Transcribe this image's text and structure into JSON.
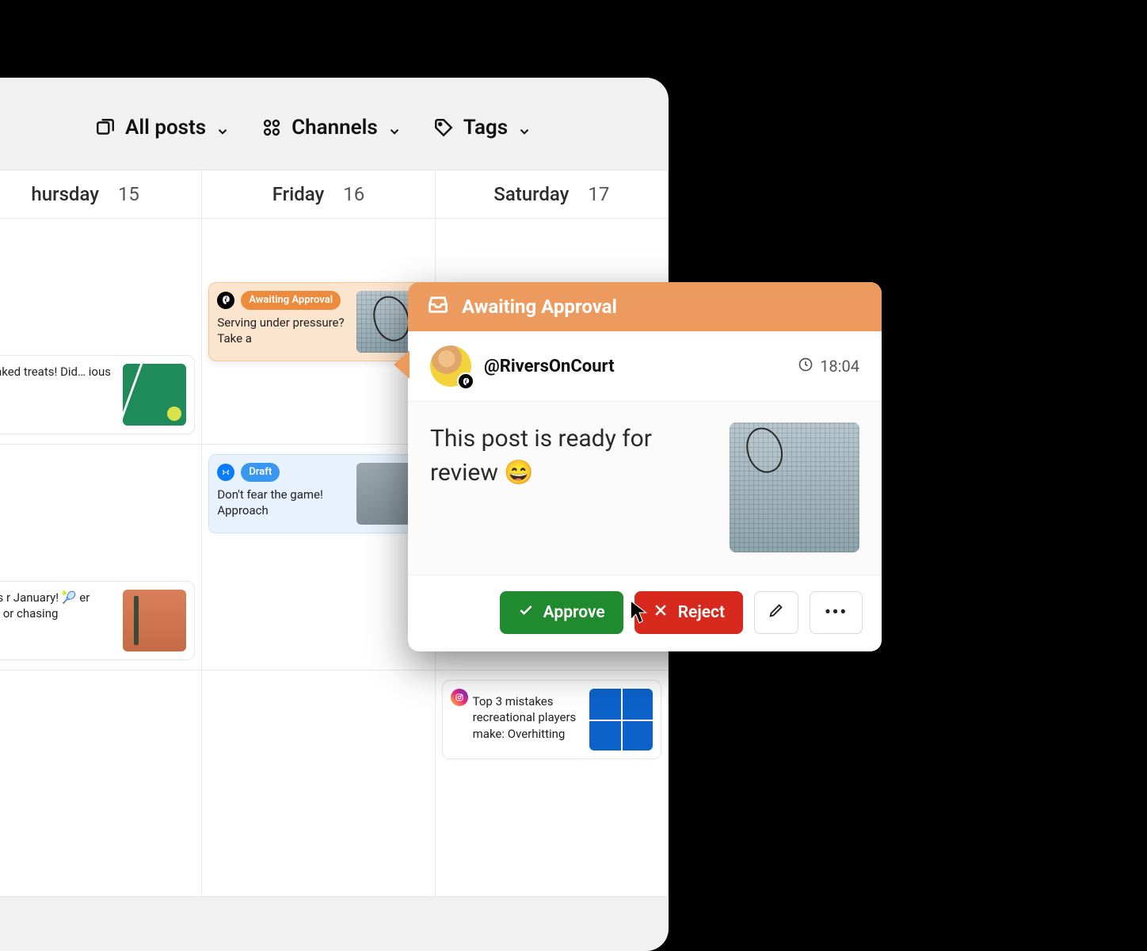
{
  "filters": {
    "all_posts": "All posts",
    "channels": "Channels",
    "tags": "Tags"
  },
  "calendar": {
    "columns": [
      {
        "day": "hursday",
        "date": "15"
      },
      {
        "day": "Friday",
        "date": "16"
      },
      {
        "day": "Saturday",
        "date": "17"
      }
    ]
  },
  "cards": {
    "approval": {
      "badge": "Awaiting Approval",
      "text": "Serving under pressure? Take a"
    },
    "baked": {
      "text": "not just baked treats! Did… ious"
    },
    "draft": {
      "badge": "Draft",
      "text": "Don't fear the game! Approach"
    },
    "sessions": {
      "text": "ssion slots r January! 🎾 er you're a er or chasing"
    },
    "mistakes": {
      "text": "Top 3 mistakes recreational players make: Overhitting"
    }
  },
  "popover": {
    "title": "Awaiting Approval",
    "username": "@RiversOnCourt",
    "time": "18:04",
    "message": "This post is ready for review 😄",
    "approve": "Approve",
    "reject": "Reject"
  }
}
